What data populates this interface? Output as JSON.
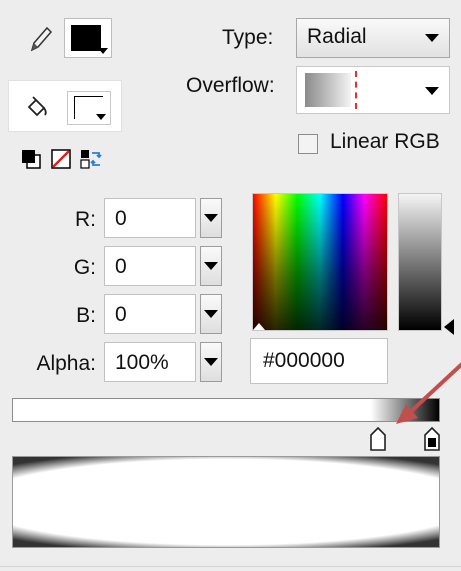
{
  "colors": {
    "stroke_color": "#000000",
    "selected_stop_color": "#ffffff",
    "end_stop_color": "#000000",
    "overflow_marker": "#e53030",
    "annotation_arrow": "#c0504d"
  },
  "icons": [
    "pencil-icon",
    "paint-bucket-icon",
    "black-and-white-icon",
    "no-color-icon",
    "swap-colors-icon",
    "dropdown-arrow-icon"
  ],
  "type": {
    "label": "Type:",
    "value": "Radial"
  },
  "overflow": {
    "label": "Overflow:"
  },
  "linear_rgb": {
    "label": "Linear RGB",
    "checked": false
  },
  "rgb": {
    "r_label": "R:",
    "r_value": "0",
    "g_label": "G:",
    "g_value": "0",
    "b_label": "B:",
    "b_value": "0",
    "alpha_label": "Alpha:",
    "alpha_value": "100%"
  },
  "hex": {
    "value": "#000000"
  }
}
